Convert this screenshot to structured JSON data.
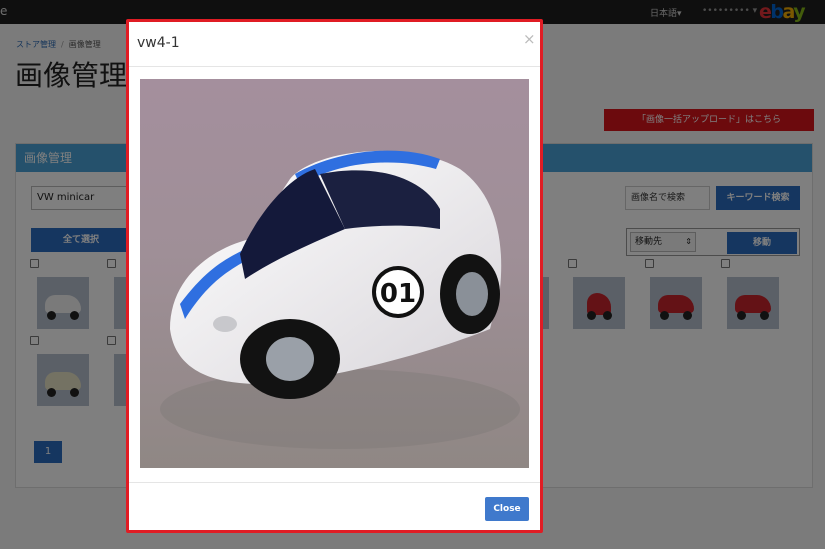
{
  "topbar": {
    "brand_fragment": "e",
    "language": "日本語▾",
    "user": "••••••••• ▾",
    "logo": "ebay"
  },
  "breadcrumb": {
    "store": "ストア管理",
    "current": "画像管理"
  },
  "page_title": "画像管理",
  "bulk_upload_label": "「画像一括アップロード」はこちら",
  "panel": {
    "heading": "画像管理",
    "album_selected": "VW minicar",
    "search_placeholder": "画像名で検索",
    "keyword_search_label": "キーワード検索",
    "select_all_label": "全て選択",
    "move_destination_selected": "移動先",
    "move_label": "移動",
    "page_current": "1"
  },
  "modal": {
    "title": "vw4-1",
    "close_x": "×",
    "close_button": "Close",
    "image_subject": "white toy VW beetle with blue stripes and number 01"
  },
  "colors": {
    "accent_red": "#d9141b",
    "panel_blue": "#4aa3d8",
    "button_blue": "#2b6cc0",
    "modal_border": "#e01c24"
  }
}
